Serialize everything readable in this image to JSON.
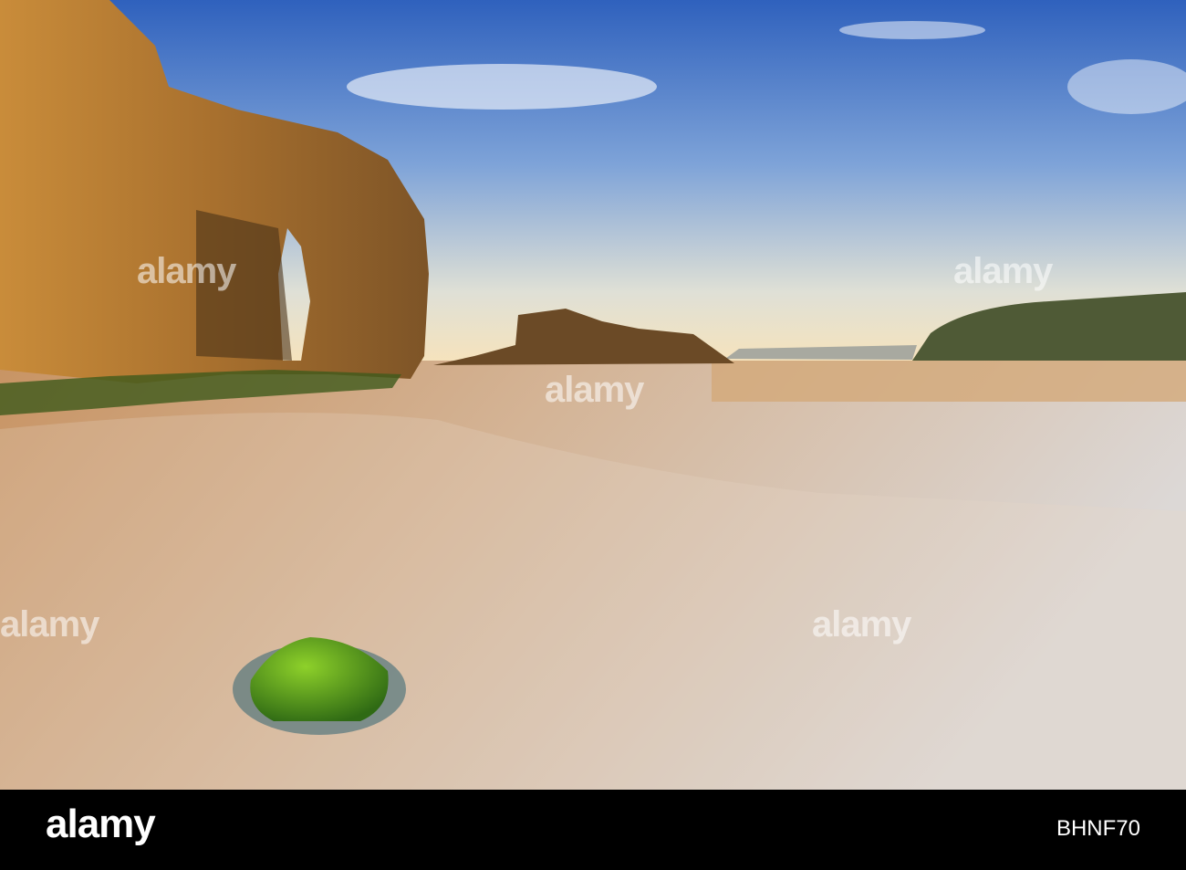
{
  "photo": {
    "subject": "beach-arch-scene",
    "colors": {
      "sky_top": "#3b6cc4",
      "sky_horizon": "#f6e4be",
      "cliff": "#b07a35",
      "sand": "#c99e6c",
      "moss": "#4f9a1e"
    }
  },
  "watermark": "alamy",
  "footer": {
    "logo": "alamy",
    "image_id": "BHNF70"
  }
}
